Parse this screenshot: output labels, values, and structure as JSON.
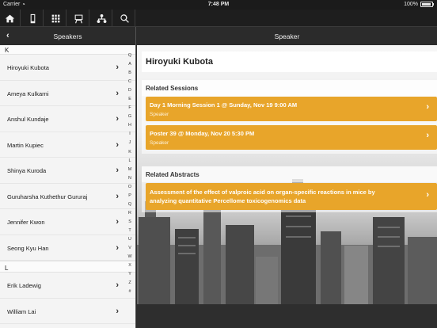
{
  "status": {
    "carrier": "Carrier",
    "time": "7:48 PM",
    "battery": "100%"
  },
  "toolbar": {
    "icons": [
      "home-icon",
      "phone-icon",
      "grid-icon",
      "easel-icon",
      "network-icon",
      "search-icon"
    ]
  },
  "left": {
    "title": "Speakers",
    "section_k": "K",
    "section_l": "L",
    "speakers_k": [
      "Hiroyuki Kubota",
      "Ameya Kulkarni",
      "Anshul Kundaje",
      "Martin Kupiec",
      "Shinya Kuroda",
      "Guruharsha Kuthethur Gururaj",
      "Jennifer Kwon",
      "Seong Kyu Han"
    ],
    "speakers_l": [
      "Erik Ladewig",
      "William Lai"
    ],
    "index": [
      "Q",
      "A",
      "B",
      "C",
      "D",
      "E",
      "F",
      "G",
      "H",
      "I",
      "J",
      "K",
      "L",
      "M",
      "N",
      "O",
      "P",
      "Q",
      "R",
      "S",
      "T",
      "U",
      "V",
      "W",
      "X",
      "Y",
      "Z",
      "#"
    ]
  },
  "right": {
    "title": "Speaker",
    "speaker_name": "Hiroyuki Kubota",
    "sessions_title": "Related Sessions",
    "sessions": [
      {
        "title": "Day 1 Morning Session 1 @ Sunday, Nov 19 9:00 AM",
        "role": "Speaker"
      },
      {
        "title": "Poster 39 @ Monday, Nov 20 5:30 PM",
        "role": "Speaker"
      }
    ],
    "abstracts_title": "Related Abstracts",
    "abstracts": [
      {
        "title_line1": "Assessment of the effect of valproic acid on organ-specific reactions in mice by",
        "title_line2": "analyzing quantitative Percellome toxicogenomics data"
      }
    ]
  },
  "colors": {
    "accent": "#e8a52a",
    "nav": "#2b2b2b"
  }
}
